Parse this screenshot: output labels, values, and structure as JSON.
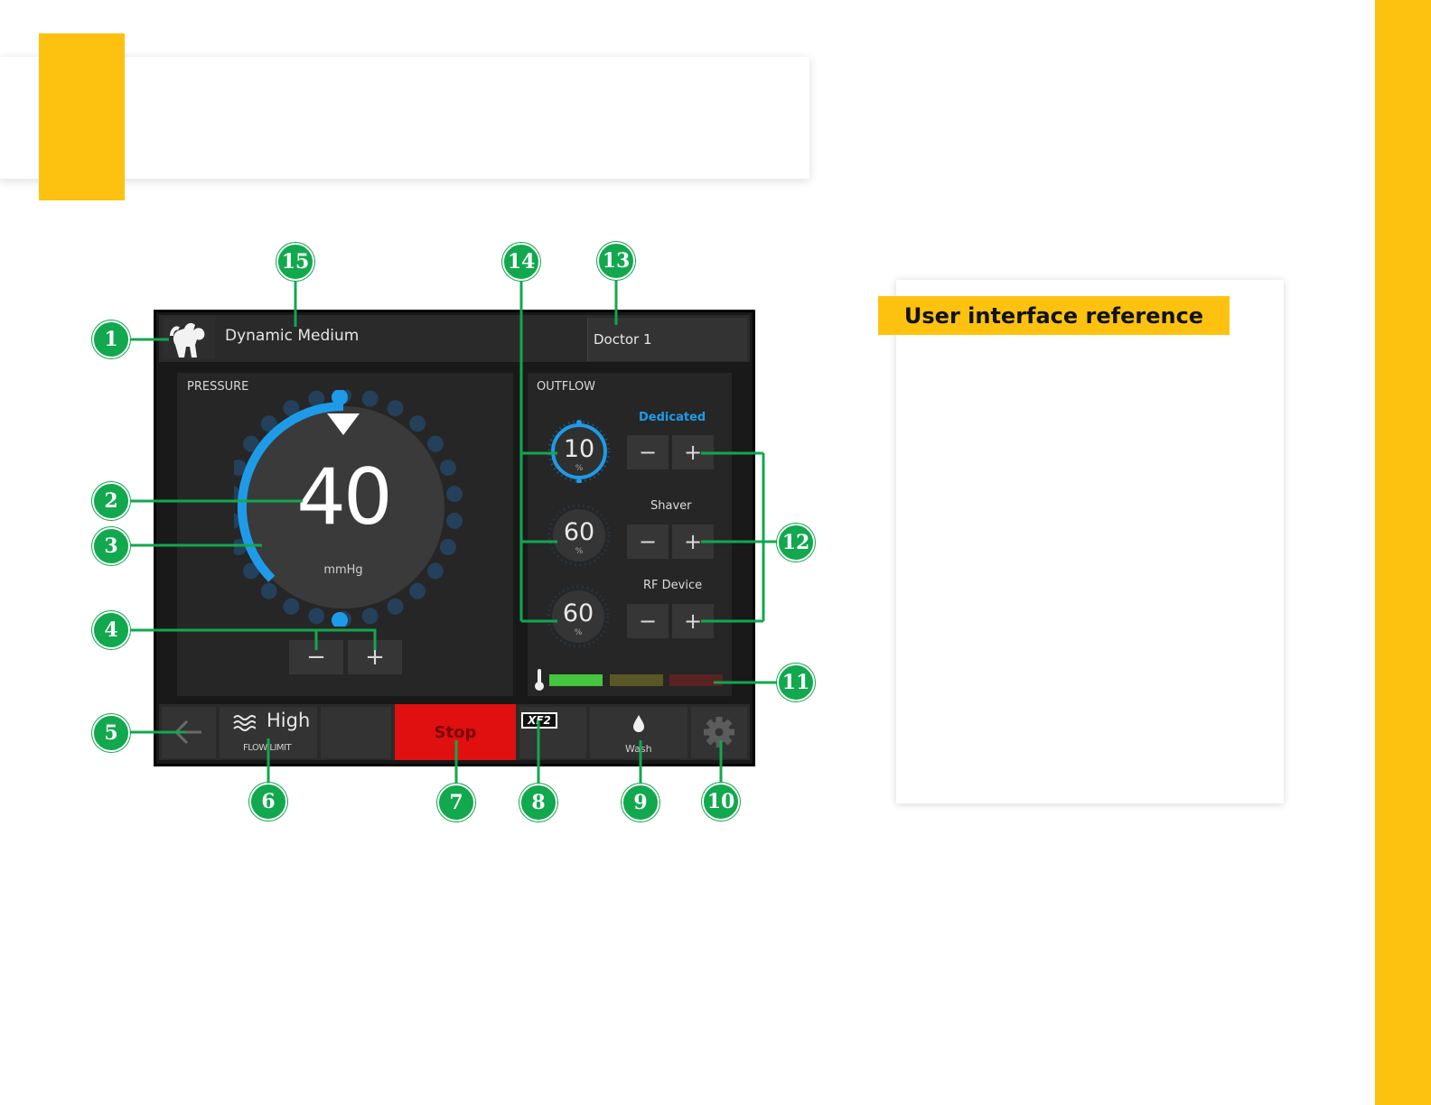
{
  "reference_panel": {
    "heading": "User interface reference"
  },
  "screen": {
    "header": {
      "mode": "Dynamic Medium",
      "user": "Doctor 1",
      "patient_icon": "joint-icon"
    },
    "pressure": {
      "title": "PRESSURE",
      "value": "40",
      "unit": "mmHg",
      "decrease_label": "−",
      "increase_label": "+"
    },
    "outflow": {
      "title": "OUTFLOW",
      "rows": [
        {
          "label": "Dedicated",
          "value": "10",
          "unit": "%",
          "active": true,
          "decrease_label": "−",
          "increase_label": "+"
        },
        {
          "label": "Shaver",
          "value": "60",
          "unit": "%",
          "active": false,
          "decrease_label": "−",
          "increase_label": "+"
        },
        {
          "label": "RF Device",
          "value": "60",
          "unit": "%",
          "active": false,
          "decrease_label": "−",
          "increase_label": "+"
        }
      ],
      "temperature_icon": "thermometer-icon"
    },
    "bottom": {
      "back_icon": "arrow-left-icon",
      "flow_icon": "waves-icon",
      "flow_value": "High",
      "flow_label": "FLOW LIMIT",
      "stop_label": "Stop",
      "xf2_label": "XF2",
      "wash_icon": "drop-icon",
      "wash_label": "Wash",
      "settings_icon": "gear-icon"
    }
  },
  "callouts": [
    "1",
    "2",
    "3",
    "4",
    "5",
    "6",
    "7",
    "8",
    "9",
    "10",
    "11",
    "12",
    "13",
    "14",
    "15"
  ],
  "colors": {
    "accent_yellow": "#fdc210",
    "callout_green": "#11a84e",
    "pressure_blue": "#1e9be8",
    "stop_red": "#e01010",
    "temp_green": "#46c63f"
  }
}
